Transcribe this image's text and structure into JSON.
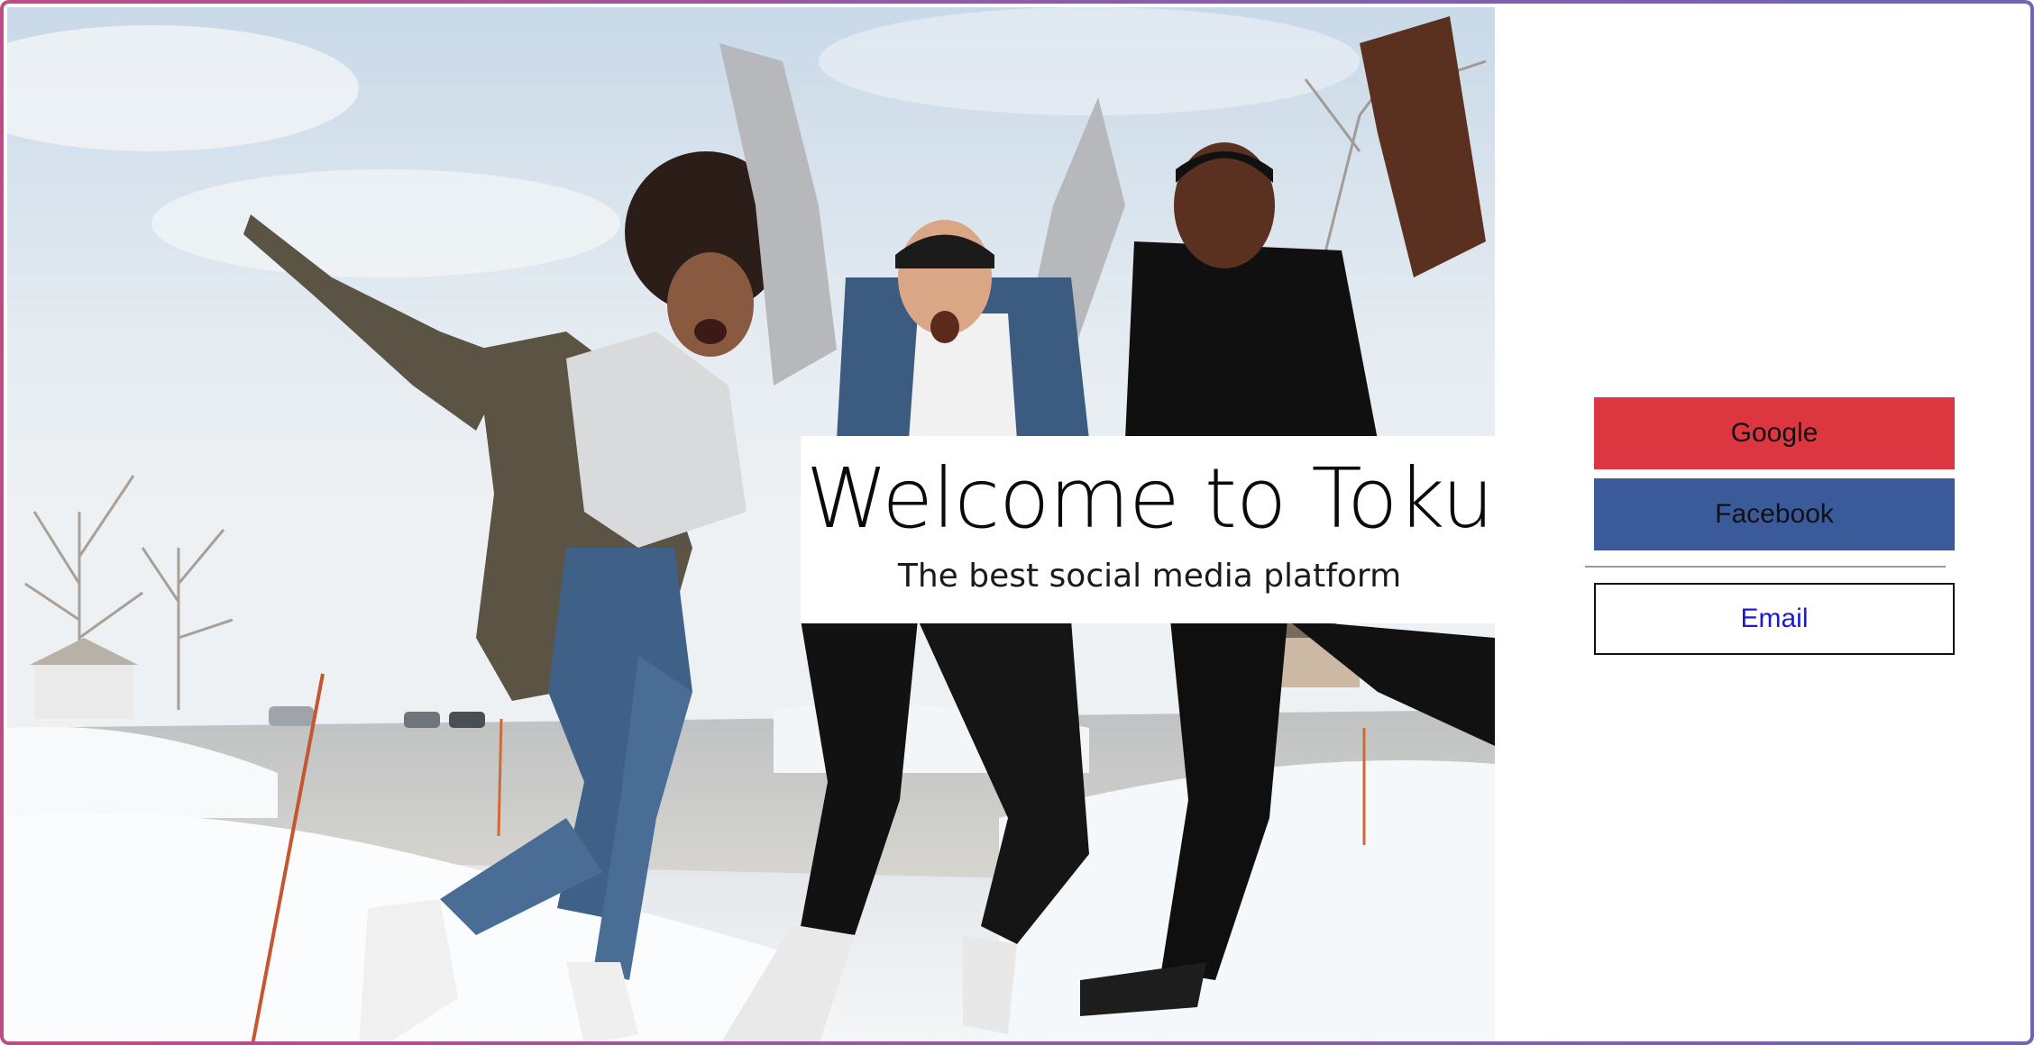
{
  "hero": {
    "image": "group-of-friends-jumping-in-snow-photo",
    "title": "Welcome to Toku",
    "subtitle": "The best social media platform"
  },
  "auth": {
    "google_label": "Google",
    "facebook_label": "Facebook",
    "email_label": "Email"
  },
  "colors": {
    "google": "#dc3740",
    "facebook": "#3b5a9a",
    "email_text": "#1a1ad8",
    "frame_gradient_start": "#c04a86",
    "frame_gradient_end": "#6f64b8"
  }
}
